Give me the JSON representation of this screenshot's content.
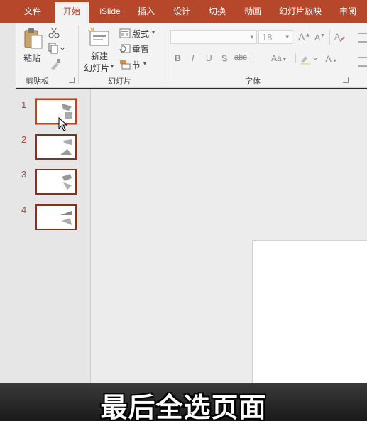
{
  "tabs": [
    {
      "label": "文件",
      "active": false
    },
    {
      "label": "开始",
      "active": true
    },
    {
      "label": "iSlide",
      "active": false
    },
    {
      "label": "插入",
      "active": false
    },
    {
      "label": "设计",
      "active": false
    },
    {
      "label": "切换",
      "active": false
    },
    {
      "label": "动画",
      "active": false
    },
    {
      "label": "幻灯片放映",
      "active": false
    },
    {
      "label": "审阅",
      "active": false
    }
  ],
  "clipboard": {
    "paste_label": "粘贴",
    "group_label": "剪贴板"
  },
  "slides_group": {
    "new_slide_line1": "新建",
    "new_slide_line2": "幻灯片",
    "layout_label": "版式",
    "reset_label": "重置",
    "section_label": "节",
    "group_label": "幻灯片"
  },
  "font_group": {
    "font_size": "18",
    "bold": "B",
    "italic": "I",
    "underline": "U",
    "shadow": "S",
    "strike": "abc",
    "case": "Aa",
    "grow": "A",
    "shrink": "A",
    "color": "A",
    "group_label": "字体"
  },
  "slides": [
    {
      "number": "1",
      "selected": true
    },
    {
      "number": "2",
      "selected": false
    },
    {
      "number": "3",
      "selected": false
    },
    {
      "number": "4",
      "selected": false
    }
  ],
  "caption": "最后全选页面",
  "colors": {
    "accent": "#b7472a",
    "thumb_border": "#8a2f1a"
  }
}
